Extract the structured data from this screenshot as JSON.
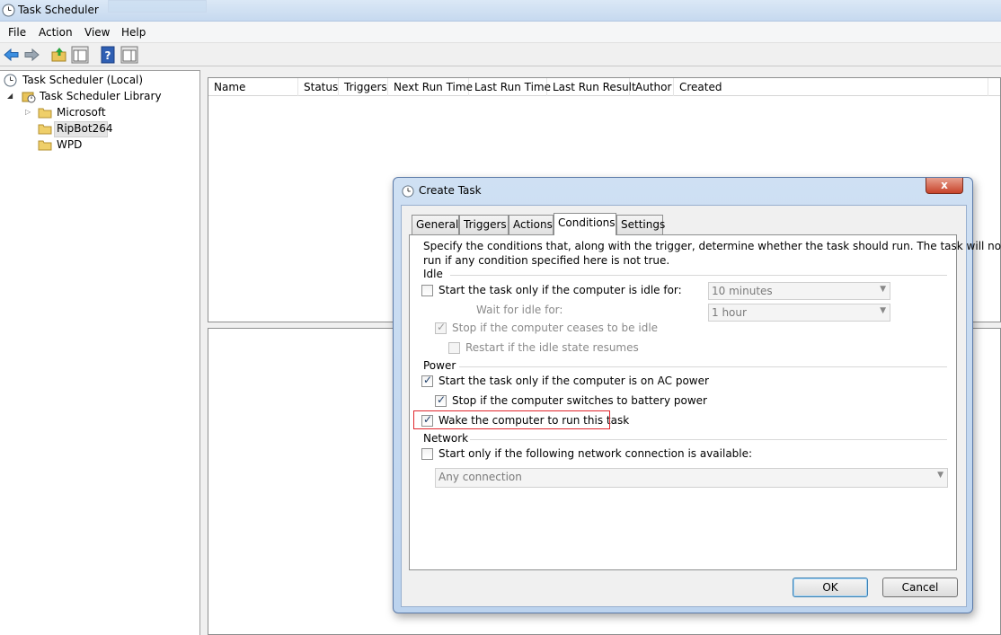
{
  "window": {
    "title": "Task Scheduler",
    "icon": "clock-icon"
  },
  "menu": [
    "File",
    "Action",
    "View",
    "Help"
  ],
  "toolbar": {
    "icons": [
      "back-arrow-icon",
      "forward-arrow-icon",
      "folder-up-icon",
      "show-hide-console-tree-icon",
      "help-icon",
      "show-hide-action-pane-icon"
    ]
  },
  "tree": {
    "root": "Task Scheduler (Local)",
    "library": "Task Scheduler Library",
    "children": [
      "Microsoft",
      "RipBot264",
      "WPD"
    ],
    "selected": "RipBot264"
  },
  "list": {
    "columns": [
      "Name",
      "Status",
      "Triggers",
      "Next Run Time",
      "Last Run Time",
      "Last Run Result",
      "Author",
      "Created"
    ]
  },
  "dialog": {
    "title": "Create Task",
    "close_label": "x",
    "tabs": [
      "General",
      "Triggers",
      "Actions",
      "Conditions",
      "Settings"
    ],
    "active_tab": "Conditions",
    "description_line1": "Specify the conditions that, along with the trigger, determine whether the task should run.  The task will not",
    "description_line2": "run  if any condition specified here is not true.",
    "idle": {
      "section": "Idle",
      "start_idle": {
        "label": "Start the task only if the computer is idle for:",
        "checked": false
      },
      "idle_duration": "10 minutes",
      "wait_label": "Wait for idle for:",
      "wait_duration": "1 hour",
      "stop_idle": {
        "label": "Stop if the computer ceases to be idle",
        "checked": true,
        "enabled": false
      },
      "restart_idle": {
        "label": "Restart if the idle state resumes",
        "checked": false,
        "enabled": false
      }
    },
    "power": {
      "section": "Power",
      "ac_power": {
        "label": "Start the task only if the computer is on AC power",
        "checked": true
      },
      "battery": {
        "label": "Stop if the computer switches to battery power",
        "checked": true
      },
      "wake": {
        "label": "Wake the computer to run this task",
        "checked": true
      }
    },
    "network": {
      "section": "Network",
      "start_network": {
        "label": "Start only if the following network connection is available:",
        "checked": false
      },
      "connection": "Any connection"
    },
    "ok_label": "OK",
    "cancel_label": "Cancel"
  }
}
